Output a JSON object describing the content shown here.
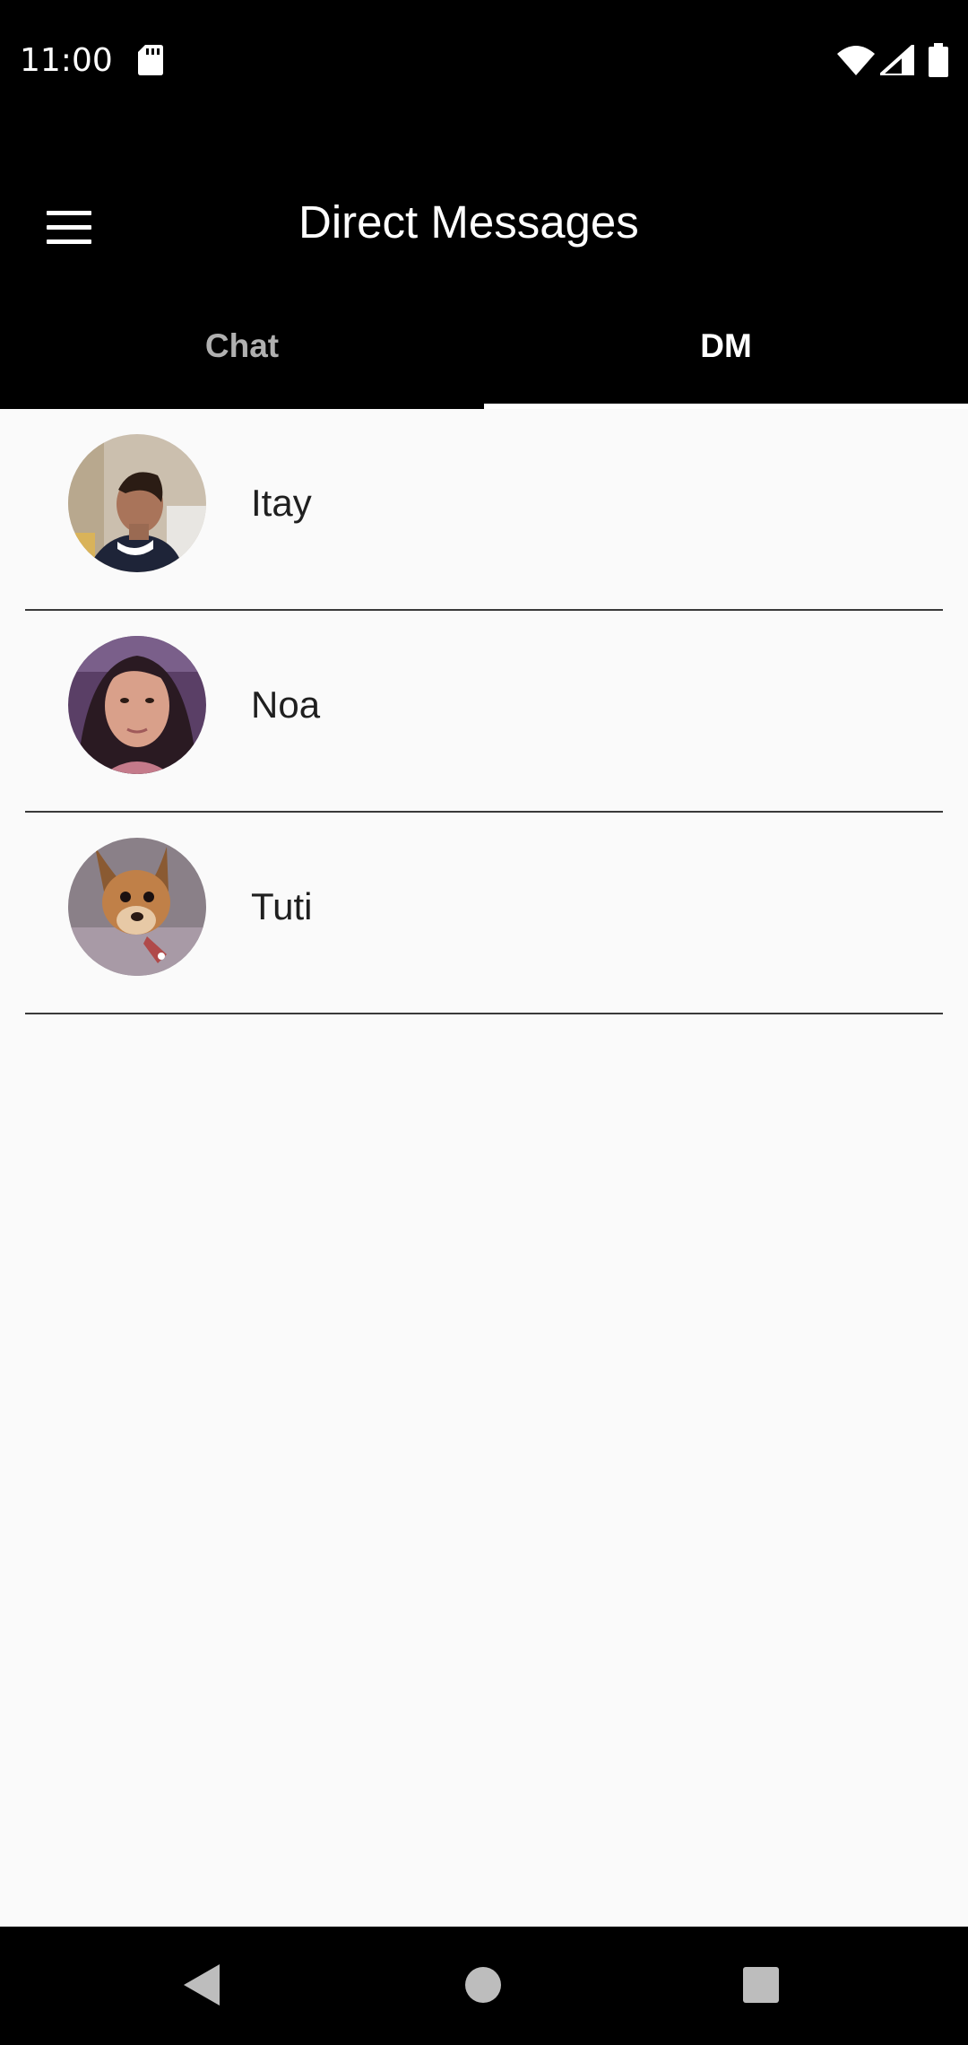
{
  "status_bar": {
    "time": "11:00",
    "icons": [
      "sd-card-icon",
      "wifi-icon",
      "signal-icon",
      "battery-icon"
    ]
  },
  "app_bar": {
    "title": "Direct Messages",
    "menu_icon": "hamburger-menu-icon"
  },
  "tabs": [
    {
      "label": "Chat",
      "selected": false
    },
    {
      "label": "DM",
      "selected": true
    }
  ],
  "dm_list": [
    {
      "name": "Itay",
      "avatar": "photo of a boy in profile"
    },
    {
      "name": "Noa",
      "avatar": "photo of a girl with dark hair"
    },
    {
      "name": "Tuti",
      "avatar": "photo of a small dog"
    }
  ],
  "nav_bar": {
    "icons": [
      "back-icon",
      "home-icon",
      "recents-icon"
    ]
  },
  "colors": {
    "bar_background": "#000000",
    "list_background": "#fafafa",
    "tab_selected": "#ffffff",
    "tab_unselected": "#b0b0b0",
    "divider": "#3a3a3a"
  }
}
